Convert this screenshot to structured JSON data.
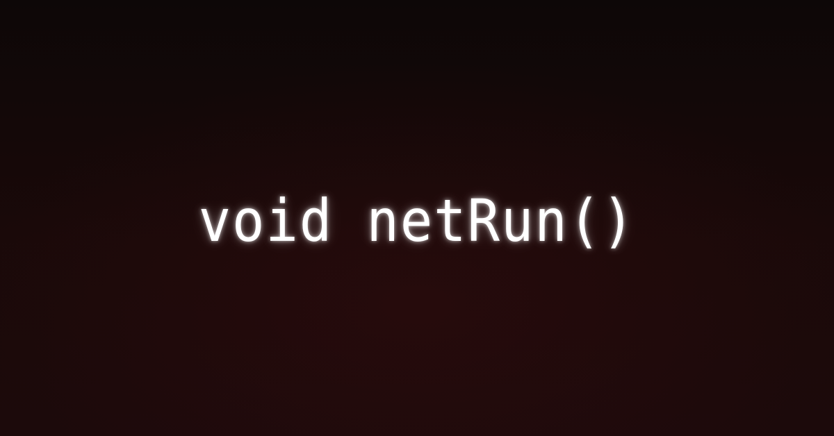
{
  "banner": {
    "title": "void netRun()",
    "colors": {
      "background_top": "#0d0707",
      "background_bottom": "#1c0a0b",
      "text": "#ffffff"
    }
  }
}
